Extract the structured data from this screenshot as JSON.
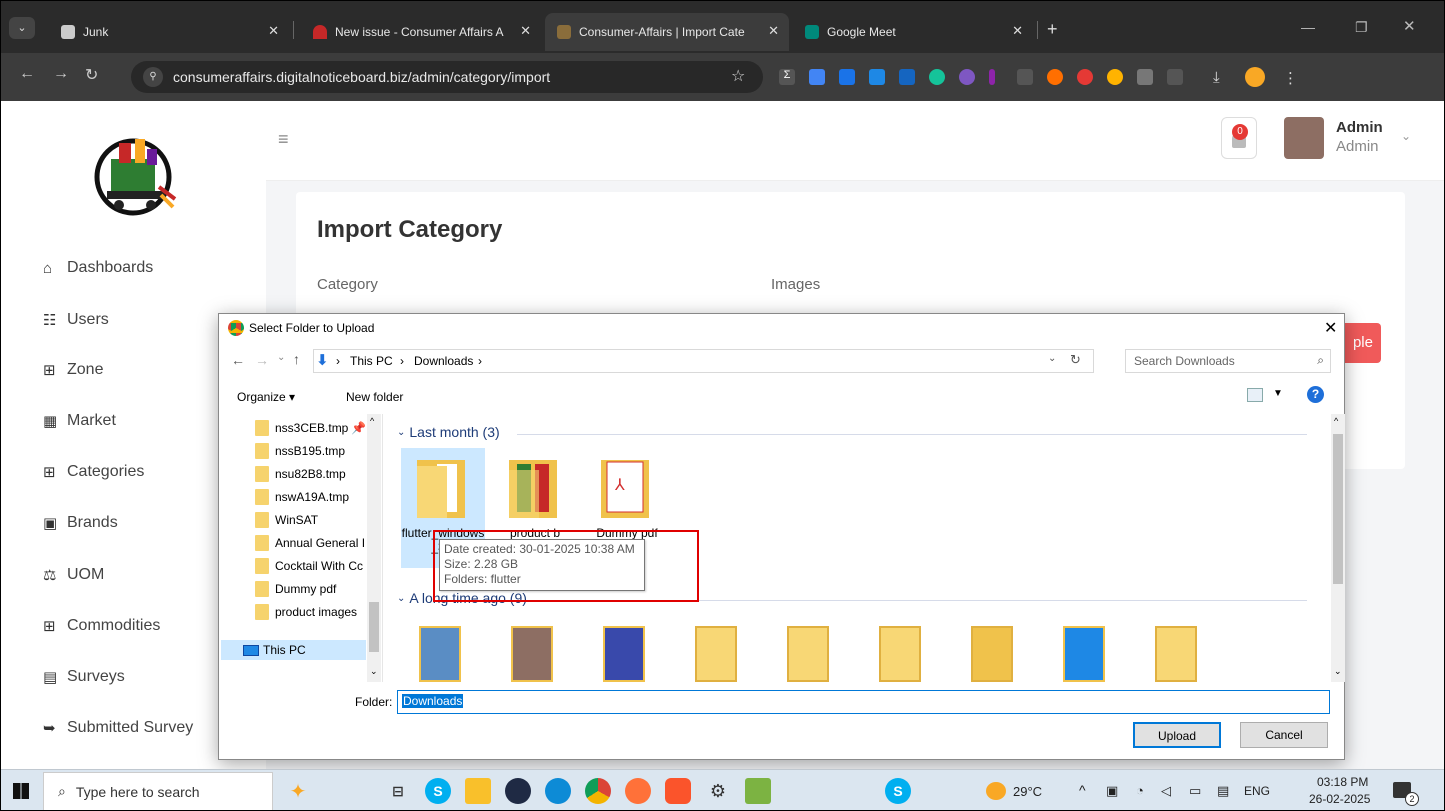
{
  "browser": {
    "tabs": [
      {
        "label": "Junk"
      },
      {
        "label": "New issue - Consumer Affairs A"
      },
      {
        "label": "Consumer-Affairs | Import Cate"
      },
      {
        "label": "Google Meet"
      }
    ],
    "url": "consumeraffairs.digitalnoticeboard.biz/admin/category/import"
  },
  "app": {
    "sidebar": {
      "items": [
        {
          "label": "Dashboards",
          "icon": "home-icon"
        },
        {
          "label": "Users",
          "icon": "users-icon"
        },
        {
          "label": "Zone",
          "icon": "grid-icon"
        },
        {
          "label": "Market",
          "icon": "market-icon"
        },
        {
          "label": "Categories",
          "icon": "grid-icon"
        },
        {
          "label": "Brands",
          "icon": "clipboard-icon"
        },
        {
          "label": "UOM",
          "icon": "scale-icon"
        },
        {
          "label": "Commodities",
          "icon": "grid-icon"
        },
        {
          "label": "Surveys",
          "icon": "form-icon"
        },
        {
          "label": "Submitted Survey",
          "icon": "submit-icon"
        }
      ]
    },
    "header": {
      "notification_count": "0",
      "user_name": "Admin",
      "user_role": "Admin"
    },
    "page_title": "Import Category",
    "form": {
      "category_label": "Category",
      "images_label": "Images",
      "sample_button_fragment": "ple"
    }
  },
  "dialog": {
    "title": "Select Folder to Upload",
    "path": [
      "This PC",
      "Downloads"
    ],
    "search_placeholder": "Search Downloads",
    "toolbar": {
      "organize": "Organize ▾",
      "new_folder": "New folder"
    },
    "nav_items": [
      "nss3CEB.tmp",
      "nssB195.tmp",
      "nsu82B8.tmp",
      "nswA19A.tmp",
      "WinSAT",
      "Annual General I",
      "Cocktail With Cc",
      "Dummy pdf",
      "product images",
      "This PC"
    ],
    "groups": [
      {
        "title": "Last month (3)"
      },
      {
        "title": "A long time ago (9)"
      }
    ],
    "files": [
      "flutter_windows_3.2",
      "product b",
      "Dummy pdf"
    ],
    "tooltip": {
      "line1": "Date created: 30-01-2025 10:38 AM",
      "line2": "Size: 2.28 GB",
      "line3": "Folders: flutter"
    },
    "folder_label": "Folder:",
    "folder_value": "Downloads",
    "upload_button": "Upload",
    "cancel_button": "Cancel"
  },
  "taskbar": {
    "search_placeholder": "Type here to search",
    "weather": "29°C",
    "lang": "ENG",
    "time": "03:18 PM",
    "date": "26-02-2025",
    "notif_count": "2"
  }
}
